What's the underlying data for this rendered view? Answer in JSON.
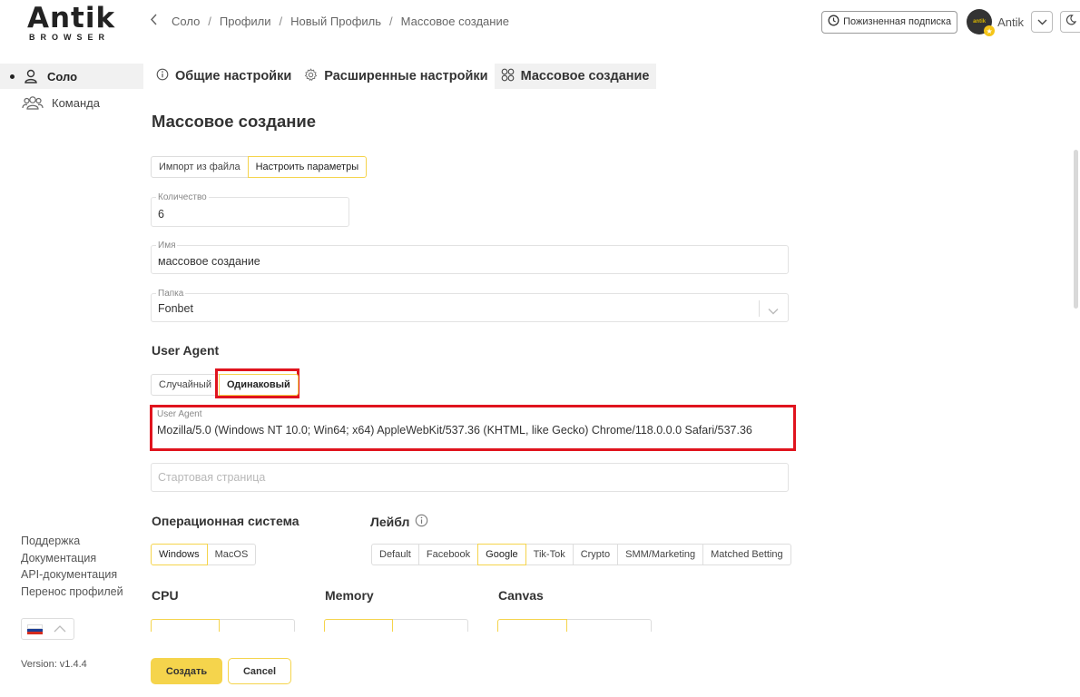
{
  "logo": {
    "main": "Antik",
    "sub": "BROWSER"
  },
  "sidebar": {
    "items": [
      {
        "label": "Соло",
        "active": true
      },
      {
        "label": "Команда",
        "active": false
      }
    ],
    "links": [
      "Поддержка",
      "Документация",
      "API-документация",
      "Перенос профилей"
    ],
    "version": "Version: v1.4.4"
  },
  "breadcrumb": [
    "Соло",
    "Профили",
    "Новый Профиль",
    "Массовое создание"
  ],
  "topbar": {
    "subscription": "Пожизненная подписка",
    "user": "Antik",
    "avatar_text": "antik"
  },
  "tabs": [
    {
      "label": "Общие настройки",
      "icon": "info-icon"
    },
    {
      "label": "Расширенные настройки",
      "icon": "gear-icon"
    },
    {
      "label": "Массовое создание",
      "icon": "grid-icon",
      "active": true
    }
  ],
  "page_title": "Массовое создание",
  "mode": {
    "options": [
      "Импорт из файла",
      "Настроить параметры"
    ],
    "selected": "Настроить параметры"
  },
  "fields": {
    "quantity": {
      "label": "Количество",
      "value": "6"
    },
    "name": {
      "label": "Имя",
      "value": "массовое создание"
    },
    "folder": {
      "label": "Папка",
      "value": "Fonbet"
    },
    "user_agent": {
      "label": "User Agent",
      "value": "Mozilla/5.0 (Windows NT 10.0; Win64; x64) AppleWebKit/537.36 (KHTML, like Gecko) Chrome/118.0.0.0 Safari/537.36"
    },
    "start_page": {
      "placeholder": "Стартовая страница"
    }
  },
  "ua_section": {
    "title": "User Agent",
    "options": [
      "Случайный",
      "Одинаковый"
    ],
    "selected": "Одинаковый"
  },
  "os_section": {
    "title": "Операционная система",
    "options": [
      "Windows",
      "MacOS"
    ],
    "selected": "Windows"
  },
  "label_section": {
    "title": "Лейбл",
    "options": [
      "Default",
      "Facebook",
      "Google",
      "Tik-Tok",
      "Crypto",
      "SMM/Marketing",
      "Matched Betting"
    ],
    "selected": "Google"
  },
  "cpu": {
    "title": "CPU"
  },
  "memory": {
    "title": "Memory"
  },
  "canvas": {
    "title": "Canvas"
  },
  "buttons": {
    "create": "Создать",
    "cancel": "Cancel"
  },
  "colors": {
    "accent": "#f5d44c",
    "highlight": "#e0141e"
  }
}
